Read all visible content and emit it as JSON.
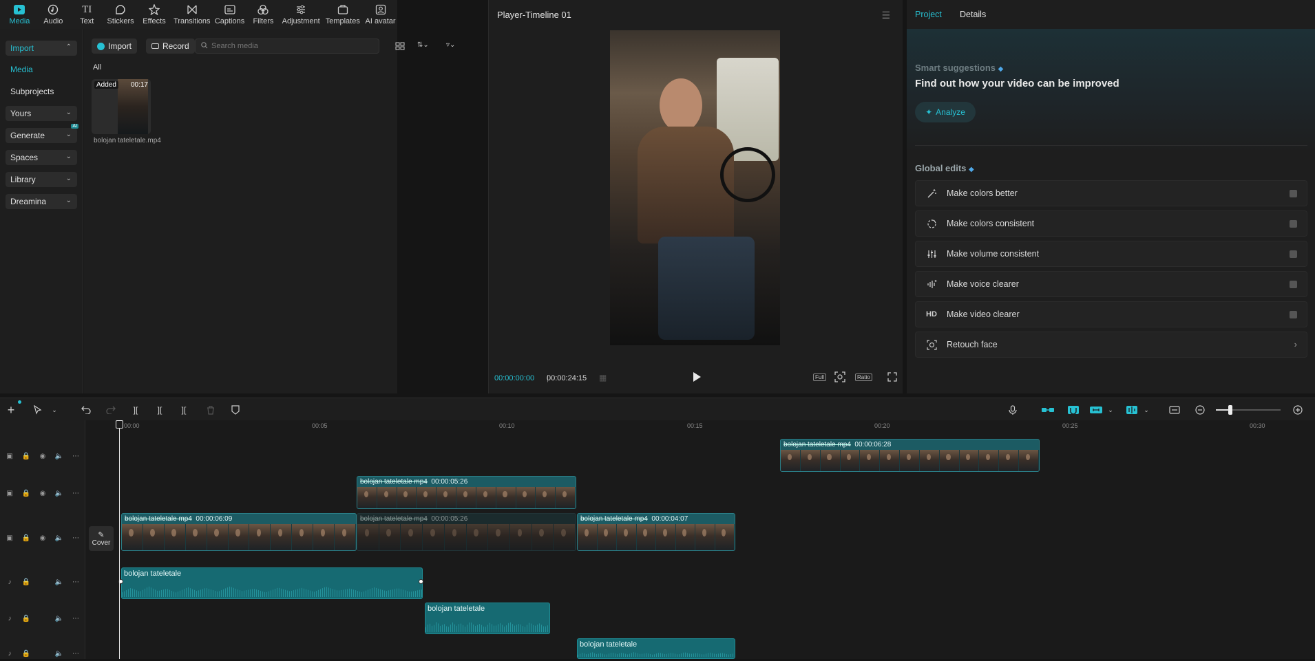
{
  "toolbar": {
    "items": [
      {
        "label": "Media",
        "icon": "media-icon"
      },
      {
        "label": "Audio",
        "icon": "audio-icon"
      },
      {
        "label": "Text",
        "icon": "text-icon"
      },
      {
        "label": "Stickers",
        "icon": "stickers-icon"
      },
      {
        "label": "Effects",
        "icon": "effects-icon"
      },
      {
        "label": "Transitions",
        "icon": "transitions-icon"
      },
      {
        "label": "Captions",
        "icon": "captions-icon"
      },
      {
        "label": "Filters",
        "icon": "filters-icon"
      },
      {
        "label": "Adjustment",
        "icon": "adjustment-icon"
      },
      {
        "label": "Templates",
        "icon": "templates-icon"
      },
      {
        "label": "AI avatar",
        "icon": "ai-avatar-icon"
      }
    ]
  },
  "leftnav": {
    "import": "Import",
    "media": "Media",
    "subprojects": "Subprojects",
    "yours": "Yours",
    "generate": "Generate",
    "generate_badge": "AI",
    "spaces": "Spaces",
    "library": "Library",
    "dreamina": "Dreamina"
  },
  "media": {
    "import_btn": "Import",
    "record_btn": "Record",
    "search_placeholder": "Search media",
    "filter_all": "All",
    "item": {
      "badge": "Added",
      "duration": "00:17",
      "filename": "bolojan tateletale.mp4"
    }
  },
  "player": {
    "title": "Player-Timeline 01",
    "current_time": "00:00:00:00",
    "total_time": "00:00:24:15",
    "full_btn": "Full",
    "ratio_btn": "Ratio"
  },
  "right": {
    "tab_project": "Project",
    "tab_details": "Details",
    "smart_title": "Smart suggestions",
    "smart_heading": "Find out how your video can be improved",
    "analyze_btn": "Analyze",
    "global_title": "Global edits",
    "global_items": [
      {
        "label": "Make colors better",
        "icon": "magic-wand-icon"
      },
      {
        "label": "Make colors consistent",
        "icon": "color-match-icon"
      },
      {
        "label": "Make volume consistent",
        "icon": "volume-sliders-icon"
      },
      {
        "label": "Make voice clearer",
        "icon": "voice-sparkle-icon"
      },
      {
        "label": "Make video clearer",
        "icon": "hd-icon",
        "icon_text": "HD"
      },
      {
        "label": "Retouch face",
        "icon": "retouch-face-icon"
      }
    ]
  },
  "timeline": {
    "ruler": [
      "00:00",
      "00:05",
      "00:10",
      "00:15",
      "00:20",
      "00:25",
      "00:30"
    ],
    "cover_label": "Cover",
    "clips": [
      {
        "name": "bolojan tateletale mp4",
        "duration": "00:00:06:28"
      },
      {
        "name": "bolojan tateletale mp4",
        "duration": "00:00:05:26"
      },
      {
        "name": "bolojan tateletale mp4",
        "duration": "00:00:06:09"
      },
      {
        "name": "bolojan tateletale mp4",
        "duration": "00:00:05:26"
      },
      {
        "name": "bolojan tateletale mp4",
        "duration": "00:00:04:07"
      }
    ],
    "audio": [
      {
        "name": "bolojan tateletale"
      },
      {
        "name": "bolojan tateletale"
      },
      {
        "name": "bolojan tateletale"
      }
    ]
  },
  "colors": {
    "accent": "#27c1d3",
    "clip": "#1c5b63",
    "audio": "#166a72"
  }
}
